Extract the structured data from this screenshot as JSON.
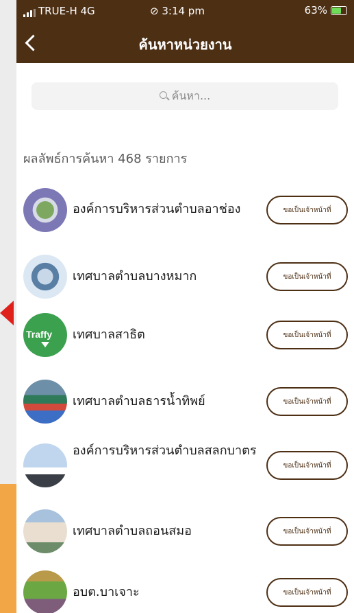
{
  "status_bar": {
    "carrier": "TRUE-H 4G",
    "time": "3:14 pm",
    "battery": "63%"
  },
  "nav": {
    "title": "ค้นหาหน่วยงาน"
  },
  "search": {
    "placeholder": "ค้นหา..."
  },
  "results": {
    "count_label": "ผลลัพธ์การค้นหา 468 รายการ",
    "items": [
      {
        "name": "องค์การบริหารส่วนตำบลอาช่อง",
        "button": "ขอเป็นเจ้าหน้าที่"
      },
      {
        "name": "เทศบาลตำบลบางหมาก",
        "button": "ขอเป็นเจ้าหน้าที่"
      },
      {
        "name": "เทศบาลสาธิต",
        "button": "ขอเป็นเจ้าหน้าที่",
        "avatar_text": "Traffy"
      },
      {
        "name": "เทศบาลตำบลธารน้ำทิพย์",
        "button": "ขอเป็นเจ้าหน้าที่"
      },
      {
        "name": "องค์การบริหารส่วนตำบลสลกบาตร",
        "button": "ขอเป็นเจ้าหน้าที่"
      },
      {
        "name": "เทศบาลตำบลถอนสมอ",
        "button": "ขอเป็นเจ้าหน้าที่"
      },
      {
        "name": "อบต.บาเจาะ",
        "button": "ขอเป็นเจ้าหน้าที่"
      }
    ]
  },
  "colors": {
    "header_bg": "#4d2f14",
    "accent_left": "#e0201b",
    "orange_strip": "#f2a645"
  }
}
